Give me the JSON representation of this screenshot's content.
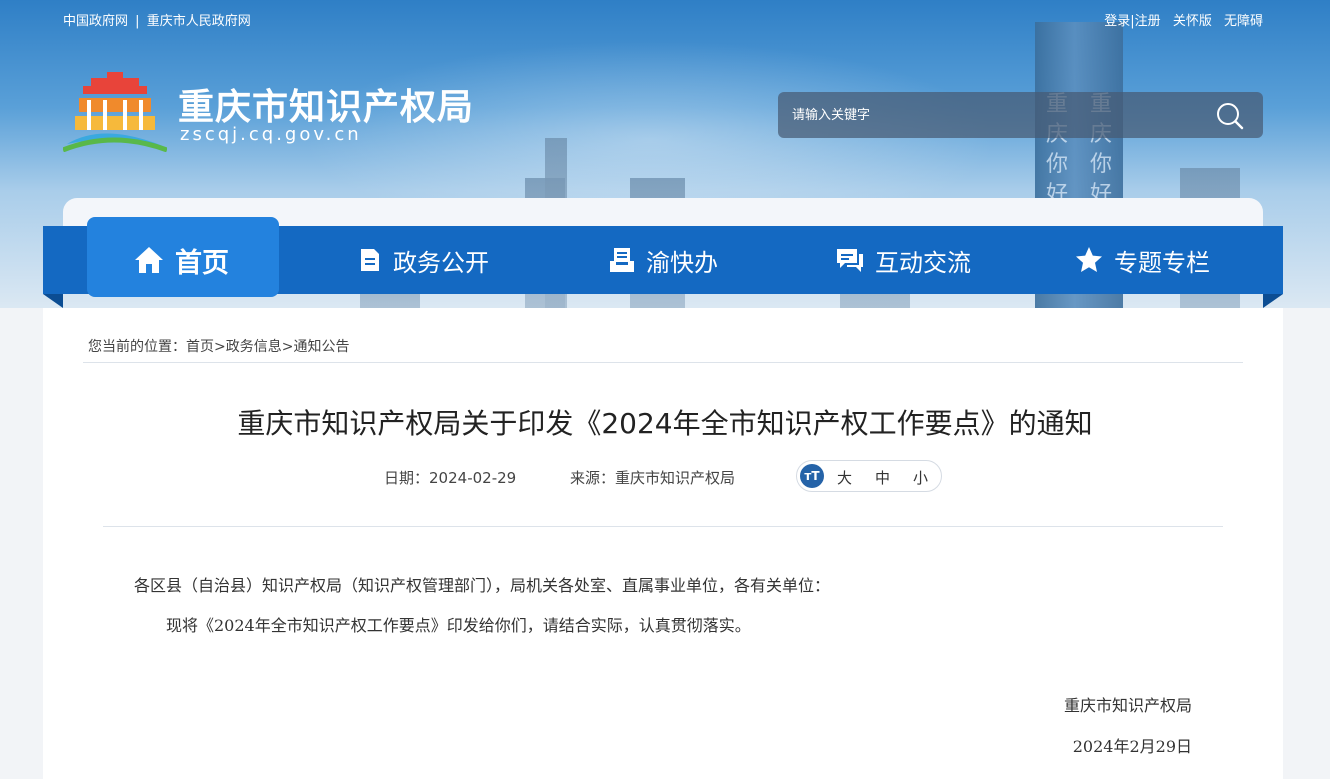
{
  "topbar": {
    "link_gov": "中国政府网",
    "separator": "|",
    "link_city": "重庆市人民政府网",
    "login": "登录|注册",
    "care": "关怀版",
    "accessible": "无障碍"
  },
  "site": {
    "title": "重庆市知识产权局",
    "domain": "zscqj.cq.gov.cn"
  },
  "banner": {
    "tower_text_left": "重庆你好",
    "tower_text_right": "重庆你好"
  },
  "search": {
    "placeholder": "请输入关键字",
    "icon": "search-icon"
  },
  "nav": {
    "items": [
      {
        "label": "首页",
        "icon": "home-icon"
      },
      {
        "label": "政务公开",
        "icon": "document-icon"
      },
      {
        "label": "渝快办",
        "icon": "tray-icon"
      },
      {
        "label": "互动交流",
        "icon": "chat-icon"
      },
      {
        "label": "专题专栏",
        "icon": "star-icon"
      }
    ],
    "active": "首页"
  },
  "breadcrumb": {
    "prefix": "您当前的位置：",
    "home": "首页",
    "sep1": ">",
    "level1": "政务信息",
    "sep2": ">",
    "level2": "通知公告"
  },
  "article": {
    "title": "重庆市知识产权局关于印发《2024年全市知识产权工作要点》的通知",
    "date_label": "日期：",
    "date": "2024-02-29",
    "source_label": "来源：",
    "source": "重庆市知识产权局",
    "font_icon_text": "тT",
    "font_large": "大",
    "font_medium": "中",
    "font_small": "小",
    "salutation": "各区县（自治县）知识产权局（知识产权管理部门），局机关各处室、直属事业单位，各有关单位：",
    "paragraph1": "现将《2024年全市知识产权工作要点》印发给你们，请结合实际，认真贯彻落实。",
    "signature": "重庆市知识产权局",
    "sign_date": "2024年2月29日"
  },
  "colors": {
    "nav_blue": "#1469c2",
    "nav_active": "#2382de",
    "accent_dark": "#2563a8"
  }
}
